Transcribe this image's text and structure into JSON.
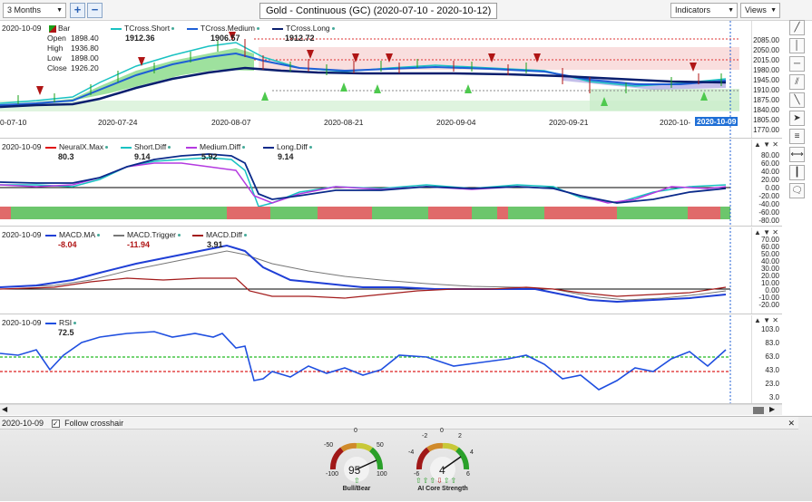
{
  "toolbar": {
    "period": "3 Months",
    "add_label": "+",
    "remove_label": "−",
    "chart_title": "Gold - Continuous (GC) (2020-07-10 - 2020-10-12)",
    "indicators": "Indicators",
    "views": "Views"
  },
  "price_pane": {
    "date": "2020-10-09",
    "bar_label": "Bar",
    "ohlc": [
      {
        "label": "Open",
        "value": "1898.40"
      },
      {
        "label": "High",
        "value": "1936.80"
      },
      {
        "label": "Low",
        "value": "1898.00"
      },
      {
        "label": "Close",
        "value": "1926.20"
      }
    ],
    "legends": [
      {
        "name": "TCross.Short",
        "value": "1912.36"
      },
      {
        "name": "TCross.Medium",
        "value": "1906.57"
      },
      {
        "name": "TCross.Long",
        "value": "1912.72"
      }
    ],
    "y_ticks": [
      "2085.00",
      "2050.00",
      "2015.00",
      "1980.00",
      "1945.00",
      "1910.00",
      "1875.00",
      "1840.00",
      "1805.00",
      "1770.00"
    ],
    "x_ticks": [
      "0-07-10",
      "2020-07-24",
      "2020-08-07",
      "2020-08-21",
      "2020-09-04",
      "2020-09-21",
      "2020-10-"
    ],
    "cursor_date": "2020-10-09"
  },
  "neural_pane": {
    "date": "2020-10-09",
    "legends": [
      {
        "name": "NeuralX.Max",
        "value": "80.3"
      },
      {
        "name": "Short.Diff",
        "value": "9.14"
      },
      {
        "name": "Medium.Diff",
        "value": "5.92"
      },
      {
        "name": "Long.Diff",
        "value": "9.14"
      }
    ],
    "y_ticks": [
      "80.00",
      "60.00",
      "40.00",
      "20.00",
      "0.00",
      "-20.00",
      "-40.00",
      "-60.00",
      "-80.00"
    ]
  },
  "macd_pane": {
    "date": "2020-10-09",
    "legends": [
      {
        "name": "MACD.MA",
        "value": "-8.04"
      },
      {
        "name": "MACD.Trigger",
        "value": "-11.94"
      },
      {
        "name": "MACD.Diff",
        "value": "3.91"
      }
    ],
    "y_ticks": [
      "70.00",
      "60.00",
      "50.00",
      "40.00",
      "30.00",
      "20.00",
      "10.00",
      "0.00",
      "-10.00",
      "-20.00"
    ]
  },
  "rsi_pane": {
    "date": "2020-10-09",
    "legends": [
      {
        "name": "RSI",
        "value": "72.5"
      }
    ],
    "y_ticks": [
      "103.0",
      "83.0",
      "63.0",
      "43.0",
      "23.0",
      "3.0"
    ]
  },
  "bottom": {
    "date": "2020-10-09",
    "follow_label": "Follow crosshair",
    "gauge1": {
      "label": "Bull/Bear",
      "value": "95",
      "min": "-100",
      "max": "100",
      "mid_left": "-50",
      "mid_right": "50",
      "top": "0"
    },
    "gauge2": {
      "label": "AI Core Strength",
      "value": "4",
      "min": "-6",
      "max": "6",
      "mid_left": "-4",
      "mid_right": "4",
      "top_left": "-2",
      "top_right": "2",
      "top": "0"
    }
  },
  "colors": {
    "short": "#19c2c2",
    "medium": "#1f5fd6",
    "long": "#0a1f6e",
    "bull": "#1aa01a",
    "bear": "#b01515",
    "neural_max": "#e01111",
    "medium_diff": "#b43ae0",
    "macd_trigger": "#777777",
    "macd_diff": "#a31b1b",
    "rsi": "#1f5fd6"
  }
}
